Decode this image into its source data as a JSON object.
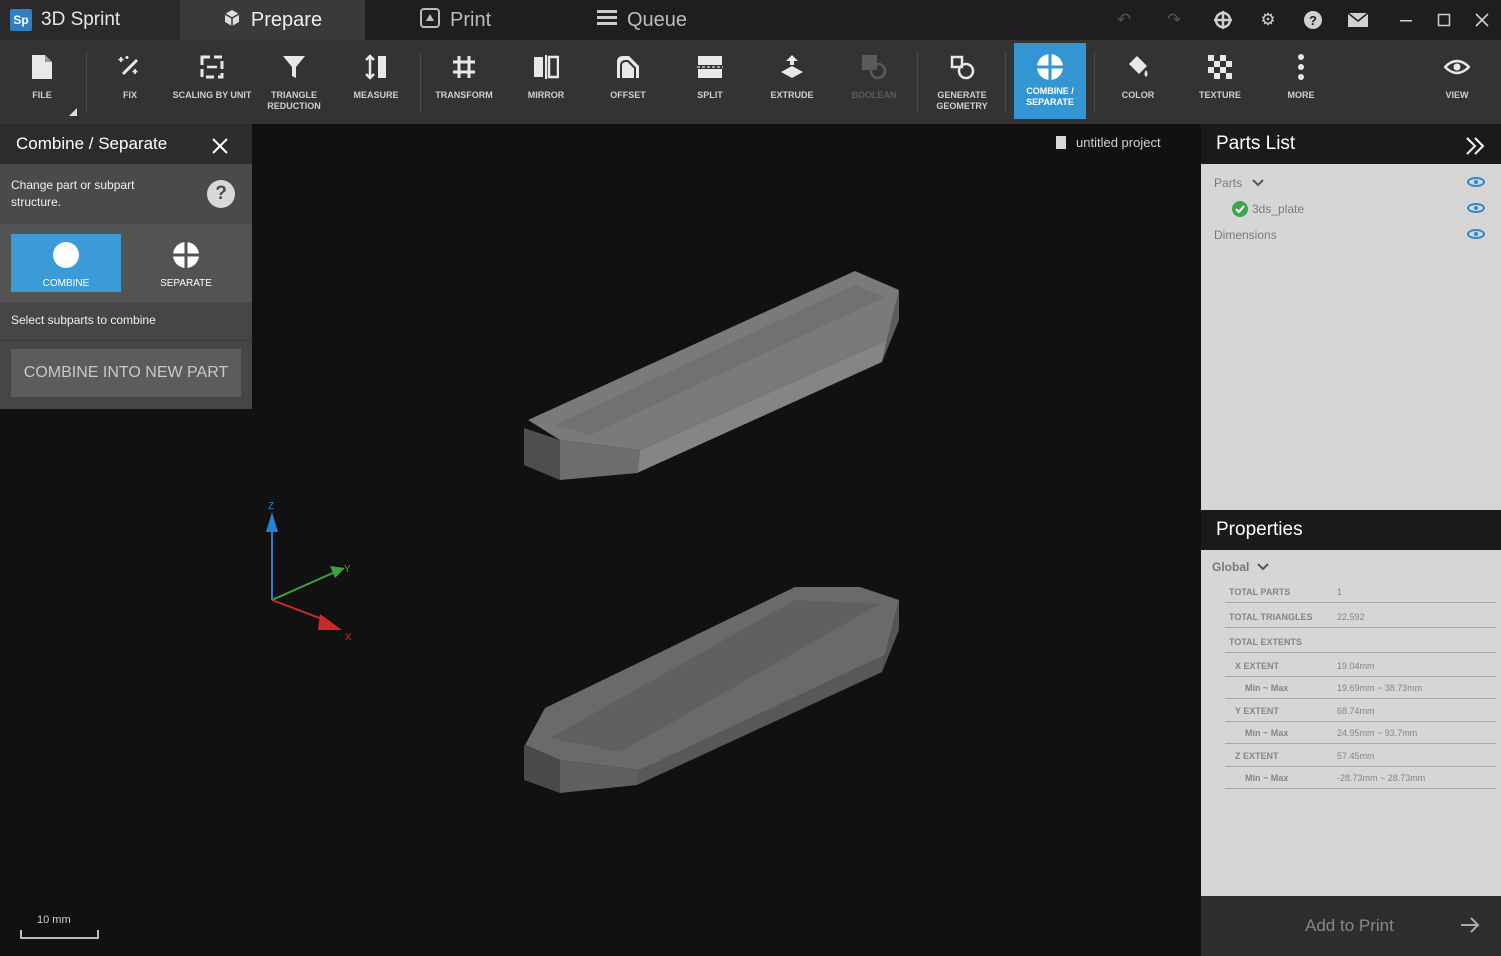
{
  "titlebar": {
    "logo_badge": "Sp",
    "app_title": "3D Sprint",
    "tabs": [
      {
        "label": "Prepare",
        "icon": "cube-icon"
      },
      {
        "label": "Print",
        "icon": "printer-icon"
      },
      {
        "label": "Queue",
        "icon": "list-icon"
      }
    ],
    "active_tab": "Prepare"
  },
  "toolbar": {
    "tools": [
      {
        "label": "FILE",
        "icon": "file-icon"
      },
      {
        "label": "FIX",
        "icon": "magic-wand-icon"
      },
      {
        "label": "SCALING BY UNIT",
        "icon": "scale-icon"
      },
      {
        "label": "TRIANGLE REDUCTION",
        "icon": "funnel-icon"
      },
      {
        "label": "MEASURE",
        "icon": "measure-icon"
      },
      {
        "label": "TRANSFORM",
        "icon": "transform-icon"
      },
      {
        "label": "MIRROR",
        "icon": "mirror-icon"
      },
      {
        "label": "OFFSET",
        "icon": "offset-icon"
      },
      {
        "label": "SPLIT",
        "icon": "split-icon"
      },
      {
        "label": "EXTRUDE",
        "icon": "extrude-icon"
      },
      {
        "label": "BOOLEAN",
        "icon": "boolean-icon"
      },
      {
        "label": "GENERATE GEOMETRY",
        "icon": "generate-geometry-icon"
      },
      {
        "label": "COMBINE / SEPARATE",
        "icon": "combine-icon"
      },
      {
        "label": "COLOR",
        "icon": "paint-bucket-icon"
      },
      {
        "label": "TEXTURE",
        "icon": "texture-icon"
      },
      {
        "label": "MORE",
        "icon": "more-vertical-icon"
      },
      {
        "label": "VIEW",
        "icon": "eye-icon"
      }
    ],
    "active_tool": "COMBINE / SEPARATE",
    "accent_color": "#3396d3"
  },
  "left_panel": {
    "title": "Combine / Separate",
    "description": "Change part or subpart structure.",
    "help_glyph": "?",
    "modes": [
      {
        "label": "COMBINE",
        "icon": "combine-circle-icon"
      },
      {
        "label": "SEPARATE",
        "icon": "separate-circle-icon"
      }
    ],
    "active_mode": "COMBINE",
    "instruction": "Select subparts to combine",
    "action_button": "COMBINE INTO NEW PART"
  },
  "viewport": {
    "project_name": "untitled project",
    "scale_label": "10 mm",
    "axis_labels": {
      "x": "X",
      "y": "Y",
      "z": "Z"
    }
  },
  "parts_list": {
    "title": "Parts List",
    "group_label": "Parts",
    "parts": [
      {
        "name": "3ds_plate",
        "status": "ok"
      }
    ],
    "dimensions_label": "Dimensions"
  },
  "properties": {
    "title": "Properties",
    "scope": "Global",
    "rows": [
      {
        "key": "TOTAL PARTS",
        "value": "1"
      },
      {
        "key": "TOTAL TRIANGLES",
        "value": "22,592"
      },
      {
        "key": "TOTAL EXTENTS",
        "value": ""
      },
      {
        "key": "X EXTENT",
        "value": "19.04mm"
      },
      {
        "key": "Min ~ Max",
        "value": "19.69mm ~ 38.73mm"
      },
      {
        "key": "Y EXTENT",
        "value": "68.74mm"
      },
      {
        "key": "Min ~ Max",
        "value": "24.95mm ~ 93.7mm"
      },
      {
        "key": "Z EXTENT",
        "value": "57.45mm"
      },
      {
        "key": "Min ~ Max",
        "value": "-28.73mm ~ 28.73mm"
      }
    ]
  },
  "footer": {
    "add_to_print": "Add to Print"
  }
}
